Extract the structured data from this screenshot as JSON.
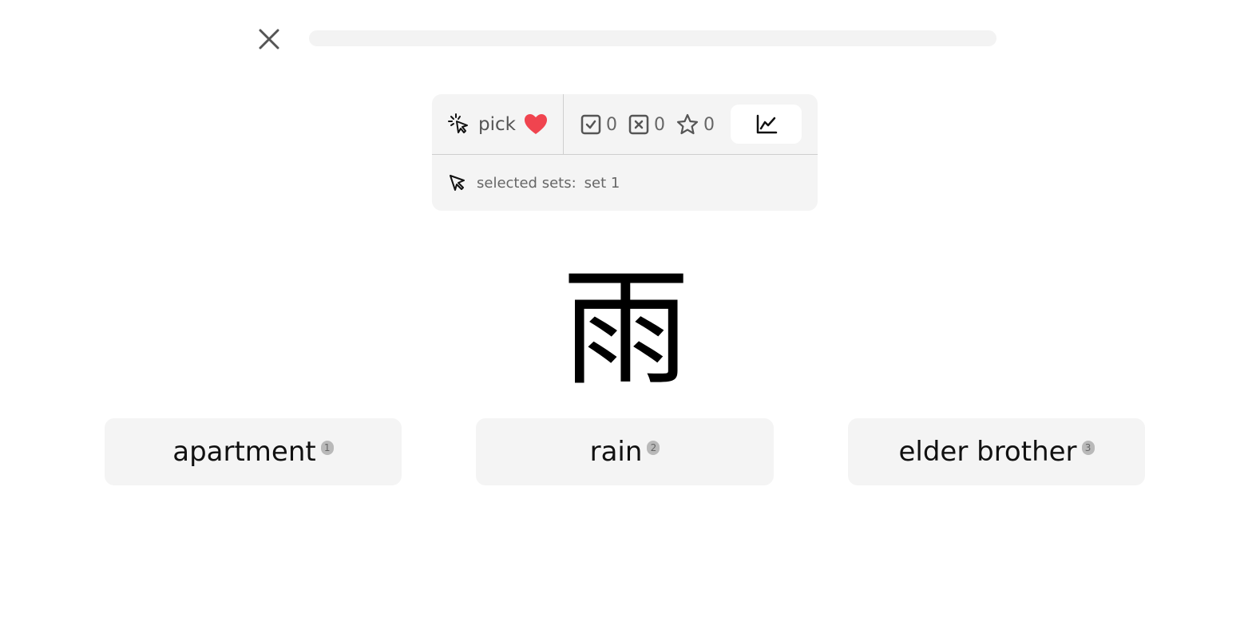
{
  "header": {
    "close_icon": "close-icon",
    "progress": 0
  },
  "panel": {
    "mode_icon": "pointer-click-icon",
    "mode_label": "pick",
    "heart_icon": "heart-icon",
    "heart_color": "#f0444f",
    "stats": {
      "correct": "0",
      "wrong": "0",
      "starred": "0"
    },
    "chart_icon": "line-chart-icon",
    "sets_label": "selected sets:",
    "sets_value": "set 1"
  },
  "question": {
    "character": "雨"
  },
  "options": [
    {
      "label": "apartment",
      "key": "1"
    },
    {
      "label": "rain",
      "key": "2"
    },
    {
      "label": "elder brother",
      "key": "3"
    }
  ]
}
